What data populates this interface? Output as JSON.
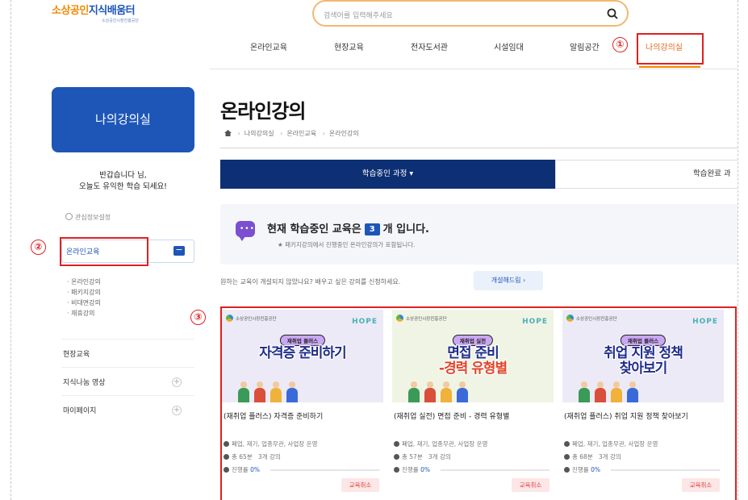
{
  "header": {
    "logo_main_a": "소상공인",
    "logo_main_b": "지식배움터",
    "logo_sub": "소상공인시장진흥공단",
    "search_placeholder": "검색어를 입력해주세요",
    "nav": [
      "온라인교육",
      "현장교육",
      "전자도서관",
      "시설임대",
      "알림공간",
      "나의강의실"
    ],
    "active_nav": "나의강의실"
  },
  "callouts": [
    "①",
    "②",
    "③"
  ],
  "sidebar": {
    "title": "나의강의실",
    "greeting_line1": "반갑습니다            님,",
    "greeting_line2": "오늘도 유익한 학습 되세요!",
    "settings": "관심정보설정",
    "active_section": "온라인교육",
    "active_toggle": "−",
    "sub_items": [
      "· 온라인강의",
      "· 패키지강의",
      "· 비대면강의",
      "· 재휴강의"
    ],
    "sections": [
      {
        "label": "현장교육",
        "plus": ""
      },
      {
        "label": "지식나눔 영상",
        "plus": "+"
      },
      {
        "label": "마이페이지",
        "plus": "+"
      }
    ]
  },
  "main": {
    "title": "온라인강의",
    "breadcrumb": [
      "나의강의실",
      "온라인교육",
      "온라인강의"
    ],
    "tab_active": "학습중인 과정 ▾",
    "tab_inactive": "학습완료 과",
    "info_prefix": "현재 학습중인 교육은",
    "info_count": "3",
    "info_suffix": "개 입니다.",
    "info_sub": "★ 패키지강의에서 진행중인 온라인강의가 포함됩니다.",
    "request_text": "원하는 교육이 개설되지 않았나요? 배우고 싶은 강의를 신청하세요.",
    "request_button": "개설해드림 ›"
  },
  "cards": [
    {
      "org": "소상공인시장진흥공단",
      "hope": "HOPE",
      "pill": "재취업 플러스",
      "banner_l1": "자격증 준비하기",
      "banner_l2": "",
      "title": "(재취업 플러스) 자격증 준비하기",
      "tags": "폐업, 재기, 업종무관, 사업장 운영",
      "duration": "총 65분",
      "lessons": "3개 강의",
      "progress_label": "진행률",
      "progress": "0%",
      "cancel": "교육취소"
    },
    {
      "org": "소상공인시장진흥공단",
      "hope": "HOPE",
      "pill": "재취업 실전",
      "banner_l1": "면접 준비",
      "banner_l2": "-경력 유형별",
      "title": "(재취업 실전) 면접 준비 - 경력 유형별",
      "tags": "폐업, 재기, 업종무관, 사업장 운영",
      "duration": "총 57분",
      "lessons": "3개 강의",
      "progress_label": "진행률",
      "progress": "0%",
      "cancel": "교육취소"
    },
    {
      "org": "소상공인시장진흥공단",
      "hope": "HOPE",
      "pill": "재취업 플러스",
      "banner_l1": "취업 지원 정책",
      "banner_l2": "찾아보기",
      "title": "(재취업 플러스) 취업 지원 정책 찾아보기",
      "tags": "폐업, 재기, 업종무관, 사업장 운영",
      "duration": "총 68분",
      "lessons": "3개 강의",
      "progress_label": "진행률",
      "progress": "0%",
      "cancel": "교육취소"
    }
  ],
  "colors": {
    "primary": "#1e56b8",
    "navy": "#0d2f73",
    "accent": "#f08a00",
    "highlight": "#e02020"
  }
}
